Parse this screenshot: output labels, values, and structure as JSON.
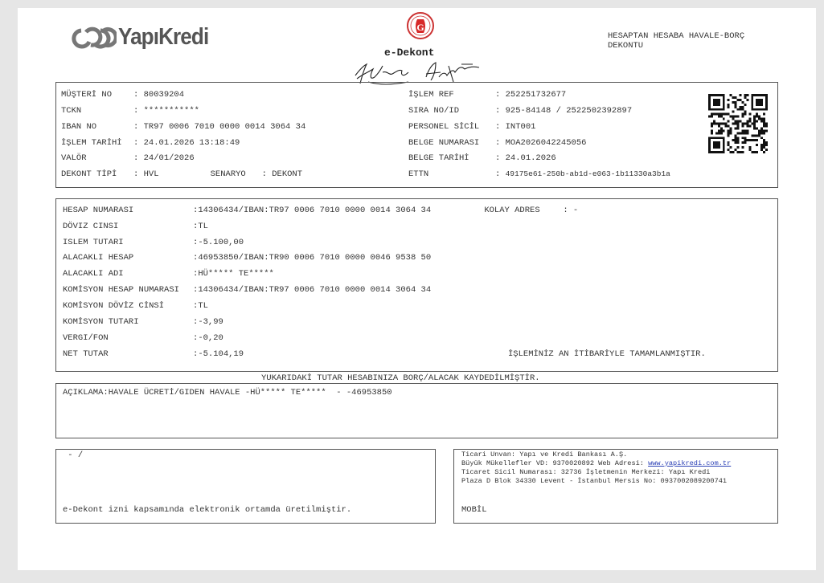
{
  "header": {
    "bank_name": "YapıKredi",
    "logo_icon": "yapikredi-logo-icon",
    "seal_icon": "seal-icon",
    "signature_icon": "signature-icon",
    "doc_name": "e-Dekont",
    "doc_title_line1": "HESAPTAN HESABA HAVALE-BORÇ",
    "doc_title_line2": "DEKONTU"
  },
  "customer": {
    "musteri_no_label": "MÜŞTERİ NO",
    "musteri_no": "80039204",
    "tckn_label": "TCKN",
    "tckn": "***********",
    "iban_no_label": "IBAN NO",
    "iban_no": "TR97 0006 7010 0000 0014 3064 34",
    "islem_tarihi_label": "İŞLEM TARİHİ",
    "islem_tarihi": "24.01.2026 13:18:49",
    "valor_label": "VALÖR",
    "valor": "24/01/2026",
    "dekont_tipi_label": "DEKONT TİPİ",
    "dekont_tipi": "HVL",
    "senaryo_label": "SENARYO",
    "senaryo": "DEKONT",
    "islem_ref_label": "İŞLEM REF",
    "islem_ref": "252251732677",
    "sira_no_label": "SIRA NO/ID",
    "sira_no": "925-84148 / 2522502392897",
    "personel_sicil_label": "PERSONEL SİCİL",
    "personel_sicil": "INT001",
    "belge_numarasi_label": "BELGE NUMARASI",
    "belge_numarasi": "MOA2026042245056",
    "belge_tarihi_label": "BELGE TARİHİ",
    "belge_tarihi": "24.01.2026",
    "ettn_label": "ETTN",
    "ettn": "49175e61-250b-ab1d-e063-1b11330a3b1a",
    "qr_icon": "qr-code-icon"
  },
  "transaction": {
    "hesap_numarasi_label": "HESAP NUMARASI",
    "hesap_numarasi": "14306434/IBAN:TR97 0006 7010 0000 0014 3064 34",
    "kolay_adres_label": "KOLAY ADRES",
    "kolay_adres": "-",
    "doviz_cinsi_label": "DÖVIZ CINSI",
    "doviz_cinsi": "TL",
    "islem_tutari_label": "ISLEM TUTARI",
    "islem_tutari": "-5.100,00",
    "alacakli_hesap_label": "ALACAKLI HESAP",
    "alacakli_hesap": "46953850/IBAN:TR90 0006 7010 0000 0046 9538 50",
    "alacakli_adi_label": "ALACAKLI ADI",
    "alacakli_adi": "HÜ***** TE*****",
    "komisyon_hesap_label": "KOMİSYON HESAP NUMARASI",
    "komisyon_hesap": "14306434/IBAN:TR97 0006 7010 0000 0014 3064 34",
    "komisyon_doviz_label": "KOMİSYON DÖVİZ CİNSİ",
    "komisyon_doviz": "TL",
    "komisyon_tutari_label": "KOMİSYON TUTARI",
    "komisyon_tutari": "-3,99",
    "vergi_label": "VERGI/FON",
    "vergi": "-0,20",
    "net_tutar_label": "NET TUTAR",
    "net_tutar": "-5.104,19",
    "status_text": "İŞLEMİNİZ AN İTİBARİYLE TAMAMLANMIŞTIR."
  },
  "notice": "YUKARIDAKİ TUTAR HESABINIZA BORÇ/ALACAK KAYDEDİLMİŞTİR.",
  "aciklama_label": "AÇIKLAMA:",
  "aciklama": "HAVALE ÜCRETİ/GIDEN HAVALE -HÜ***** TE*****  - -46953850",
  "footer": {
    "left_top": " - /",
    "left_bottom": "e-Dekont izni kapsamında elektronik ortamda üretilmiştir.",
    "company_line1": "Ticari Unvan: Yapı ve Kredi Bankası A.Ş.",
    "company_line2a": "Büyük Mükellefler VD: 9370020892 Web Adresi: ",
    "company_link": "www.yapikredi.com.tr",
    "company_line3": "Ticaret Sicil Numarası: 32736 İşletmenin Merkezi: Yapı Kredi",
    "company_line4": "Plaza D Blok 34330 Levent - İstanbul Mersis No: 0937002089200741",
    "channel": "MOBİL"
  }
}
